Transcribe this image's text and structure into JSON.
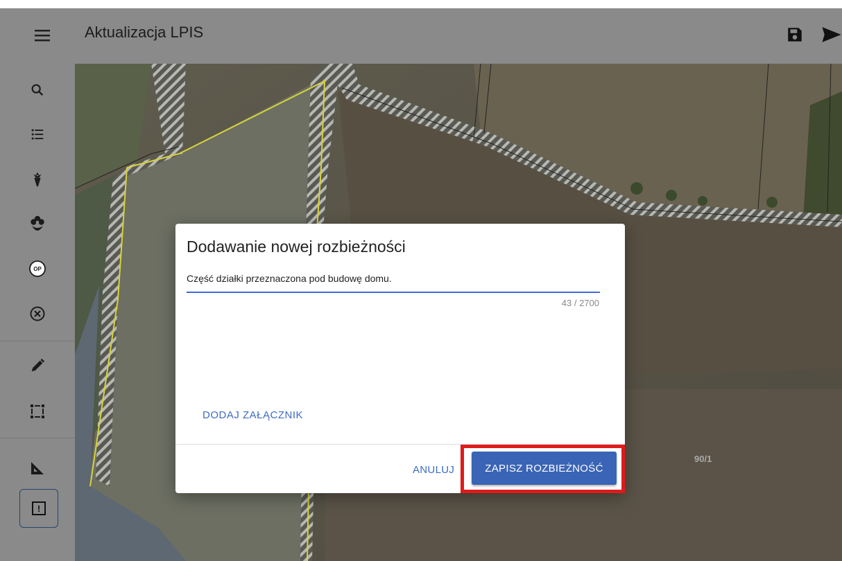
{
  "header": {
    "title": "Aktualizacja LPIS",
    "icons": {
      "menu": "menu-icon",
      "save": "floppy-disk-icon",
      "send": "send-icon"
    }
  },
  "sidebar": {
    "items": [
      {
        "icon": "search-icon"
      },
      {
        "icon": "list-icon"
      },
      {
        "icon": "crop-plant-icon"
      },
      {
        "icon": "flower-icon"
      },
      {
        "icon": "op-badge-icon",
        "label": "OP"
      },
      {
        "icon": "cancel-circle-icon"
      },
      {
        "icon": "pencil-icon"
      },
      {
        "icon": "selection-rectangle-icon"
      },
      {
        "icon": "measure-ruler-icon"
      },
      {
        "icon": "report-issue-icon",
        "label": "!"
      }
    ]
  },
  "map": {
    "parcel_label": "90/1"
  },
  "dialog": {
    "title": "Dodawanie nowej rozbieżności",
    "description_value": "Część działki przeznaczona pod budowę domu.",
    "char_counter": "43 / 2700",
    "attach_label": "DODAJ ZAŁĄCZNIK",
    "cancel_label": "ANULUJ",
    "save_label": "ZAPISZ ROZBIEŻNOŚĆ"
  },
  "colors": {
    "accent": "#3a64b5",
    "highlight": "#e11a1a",
    "chrome": "#8a8a8a"
  }
}
